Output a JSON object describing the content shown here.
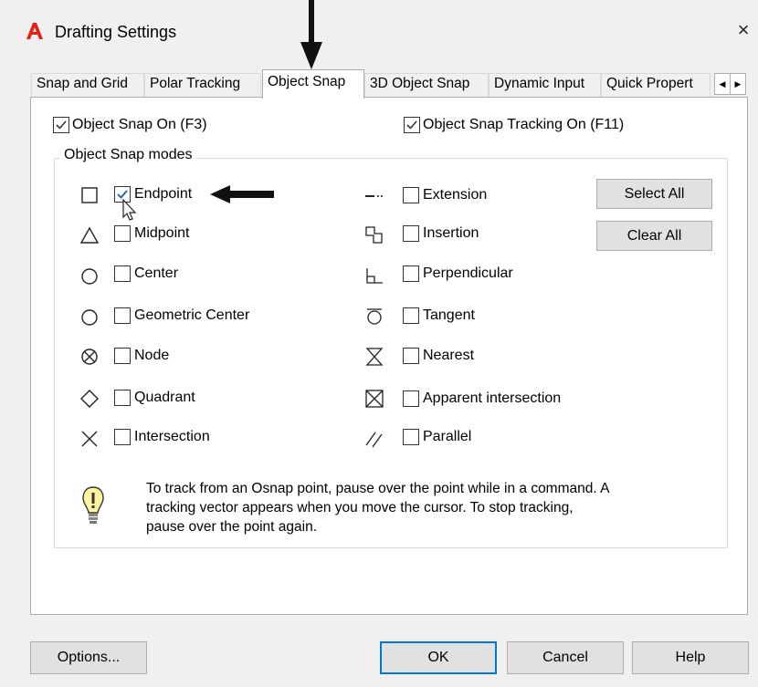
{
  "window": {
    "title": "Drafting Settings",
    "close_glyph": "×"
  },
  "tabs": [
    "Snap and Grid",
    "Polar Tracking",
    "Object Snap",
    "3D Object Snap",
    "Dynamic Input",
    "Quick Propert"
  ],
  "active_tab": "Object Snap",
  "toggles": {
    "object_snap_on": {
      "label": "Object Snap On (F3)",
      "checked": true
    },
    "object_snap_tracking_on": {
      "label": "Object Snap Tracking On (F11)",
      "checked": true
    }
  },
  "modes_group_title": "Object Snap modes",
  "modes_left": [
    {
      "label": "Endpoint",
      "checked": true,
      "icon": "endpoint-icon"
    },
    {
      "label": "Midpoint",
      "checked": false,
      "icon": "midpoint-icon"
    },
    {
      "label": "Center",
      "checked": false,
      "icon": "center-icon"
    },
    {
      "label": "Geometric Center",
      "checked": false,
      "icon": "geometric-center-icon"
    },
    {
      "label": "Node",
      "checked": false,
      "icon": "node-icon"
    },
    {
      "label": "Quadrant",
      "checked": false,
      "icon": "quadrant-icon"
    },
    {
      "label": "Intersection",
      "checked": false,
      "icon": "intersection-icon"
    }
  ],
  "modes_right": [
    {
      "label": "Extension",
      "checked": false,
      "icon": "extension-icon"
    },
    {
      "label": "Insertion",
      "checked": false,
      "icon": "insertion-icon"
    },
    {
      "label": "Perpendicular",
      "checked": false,
      "icon": "perpendicular-icon"
    },
    {
      "label": "Tangent",
      "checked": false,
      "icon": "tangent-icon"
    },
    {
      "label": "Nearest",
      "checked": false,
      "icon": "nearest-icon"
    },
    {
      "label": "Apparent intersection",
      "checked": false,
      "icon": "apparent-intersection-icon"
    },
    {
      "label": "Parallel",
      "checked": false,
      "icon": "parallel-icon"
    }
  ],
  "side_buttons": {
    "select_all": "Select All",
    "clear_all": "Clear All"
  },
  "hint": {
    "line1": "To track from an Osnap point, pause over the point while in a command.  A",
    "line2": "tracking vector appears when you move the cursor.  To stop tracking,",
    "line3": "pause over the point again."
  },
  "footer": {
    "options": "Options...",
    "ok": "OK",
    "cancel": "Cancel",
    "help": "Help"
  },
  "colors": {
    "brand": "#e2231a",
    "check": "#1a5fb4",
    "default_button_border": "#0078d7"
  }
}
